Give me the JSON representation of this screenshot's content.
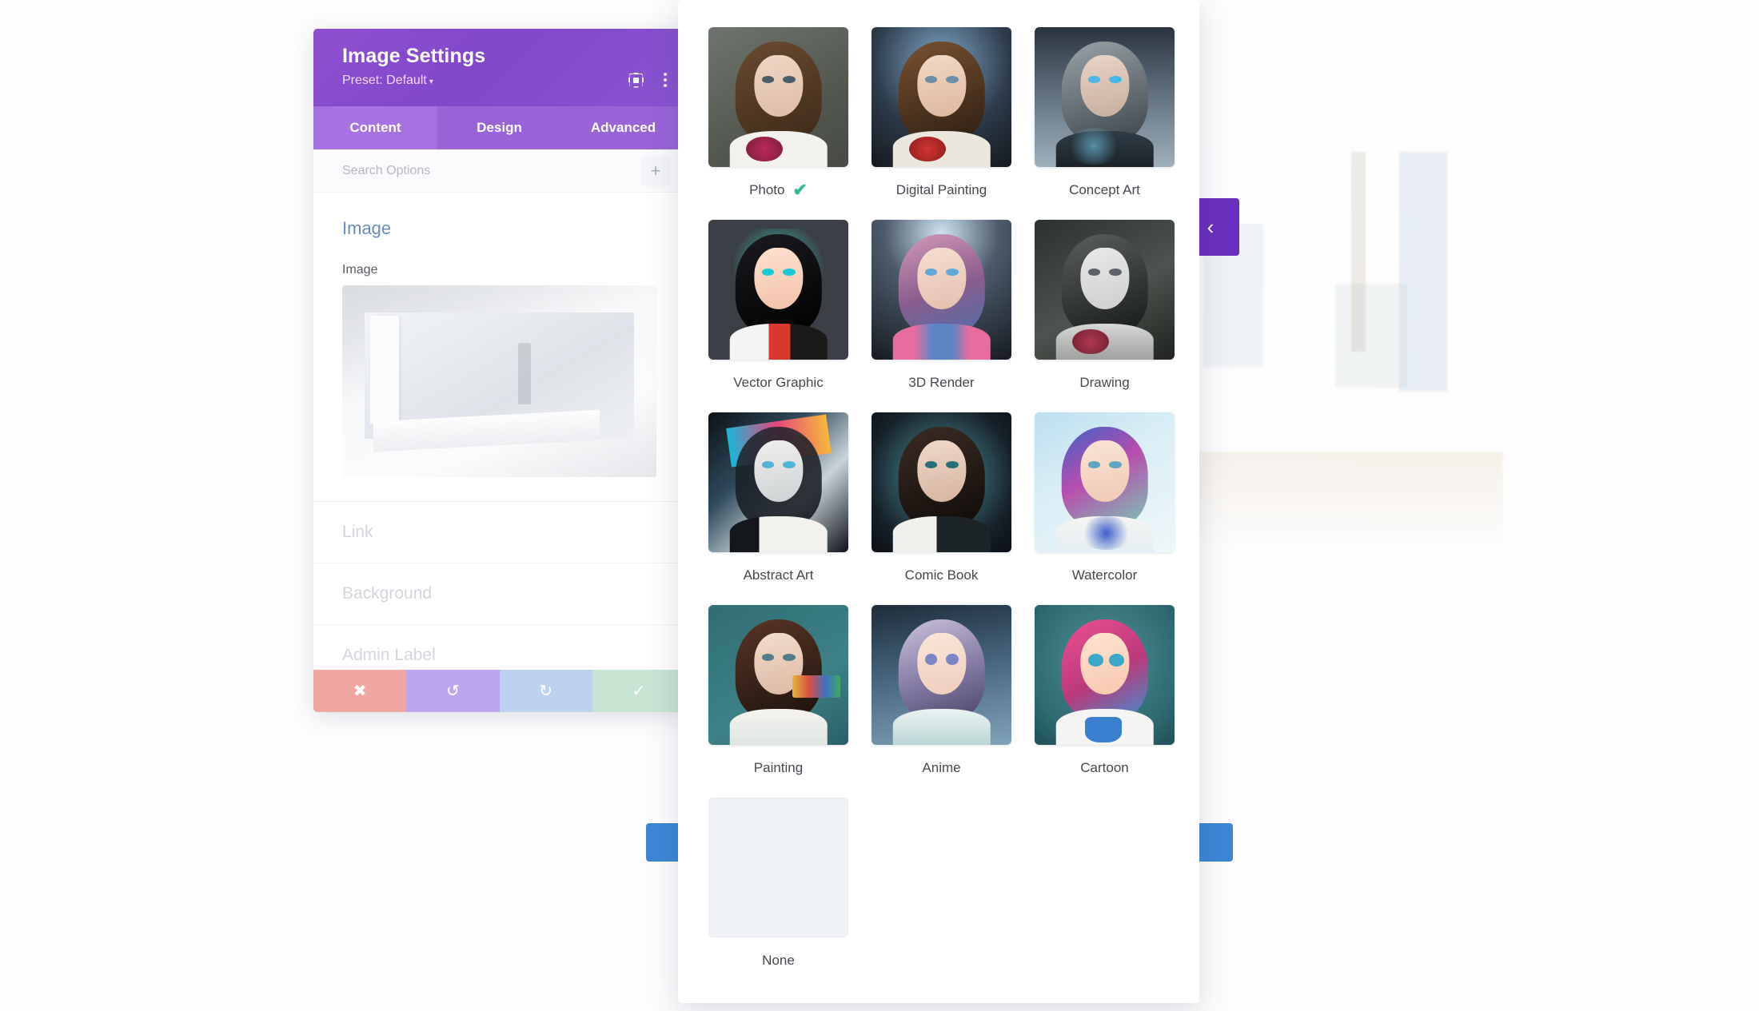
{
  "settings_panel": {
    "title": "Image Settings",
    "preset": "Preset: Default",
    "preset_caret": "▾",
    "tabs": [
      {
        "label": "Content",
        "active": true
      },
      {
        "label": "Design",
        "active": false
      },
      {
        "label": "Advanced",
        "active": false
      }
    ],
    "search_placeholder": "Search Options",
    "add_icon": "+",
    "section_title": "Image",
    "field_label": "Image",
    "rows": [
      {
        "label": "Link"
      },
      {
        "label": "Background"
      },
      {
        "label": "Admin Label"
      }
    ],
    "bottom_bar": [
      {
        "name": "close",
        "glyph": "✖"
      },
      {
        "name": "undo",
        "glyph": "↺"
      },
      {
        "name": "redo",
        "glyph": "↻"
      },
      {
        "name": "save",
        "glyph": "✓"
      }
    ],
    "header_icons": [
      {
        "name": "focus-icon"
      },
      {
        "name": "more-options-icon"
      }
    ]
  },
  "peek_buttons": {
    "prev_chevron": "‹",
    "next_chevron": "‹"
  },
  "modal": {
    "selected": "Photo",
    "check_glyph": "✔",
    "check_color": "#38b894",
    "options": [
      {
        "label": "Photo",
        "selected": true
      },
      {
        "label": "Digital Painting",
        "selected": false
      },
      {
        "label": "Concept Art",
        "selected": false
      },
      {
        "label": "Vector Graphic",
        "selected": false
      },
      {
        "label": "3D Render",
        "selected": false
      },
      {
        "label": "Drawing",
        "selected": false
      },
      {
        "label": "Abstract Art",
        "selected": false
      },
      {
        "label": "Comic Book",
        "selected": false
      },
      {
        "label": "Watercolor",
        "selected": false
      },
      {
        "label": "Painting",
        "selected": false
      },
      {
        "label": "Anime",
        "selected": false
      },
      {
        "label": "Cartoon",
        "selected": false
      },
      {
        "label": "None",
        "selected": false
      }
    ]
  },
  "colors": {
    "panel_header_purple": "#8347cc",
    "tab_active_purple": "#a771e2",
    "accent_green": "#38b894",
    "peek_purple": "#6b2fbf",
    "peek_blue": "#3d86d6"
  }
}
